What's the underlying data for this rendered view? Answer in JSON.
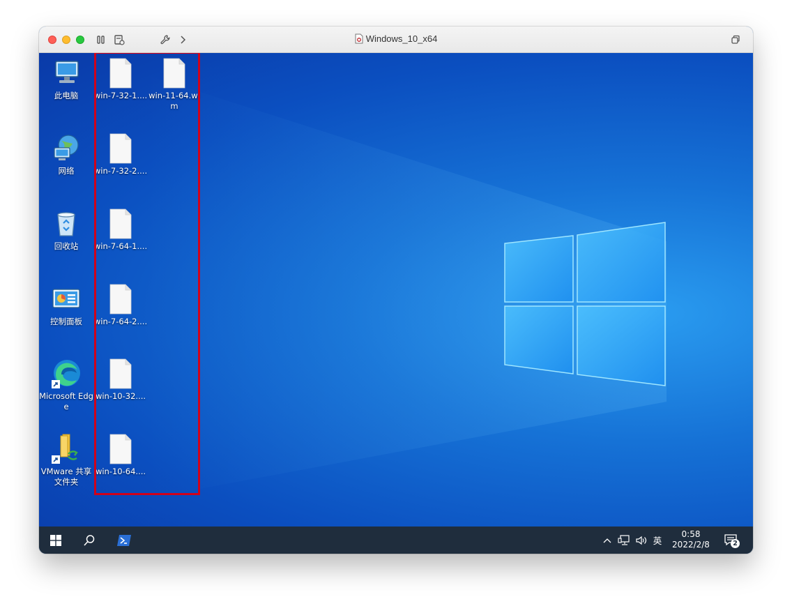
{
  "window": {
    "title": "Windows_10_x64"
  },
  "desktop": {
    "system_icons": [
      {
        "label": "此电脑",
        "icon": "computer-icon"
      },
      {
        "label": "网络",
        "icon": "network-globe-icon"
      },
      {
        "label": "回收站",
        "icon": "recycle-bin-icon"
      },
      {
        "label": "控制面板",
        "icon": "control-panel-icon"
      },
      {
        "label": "Microsoft Edge",
        "icon": "edge-browser-icon"
      },
      {
        "label": "VMware 共享文件夹",
        "icon": "shared-folder-icon"
      }
    ],
    "files": [
      {
        "label": "win-7-32-1...."
      },
      {
        "label": "win-11-64.wim"
      },
      {
        "label": "win-7-32-2...."
      },
      {
        "label": "win-7-64-1...."
      },
      {
        "label": "win-7-64-2...."
      },
      {
        "label": "win-10-32...."
      },
      {
        "label": "win-10-64...."
      }
    ],
    "highlight_color": "#d0021b"
  },
  "taskbar": {
    "ime": "英",
    "time": "0:58",
    "date": "2022/2/8",
    "notification_count": "2"
  }
}
